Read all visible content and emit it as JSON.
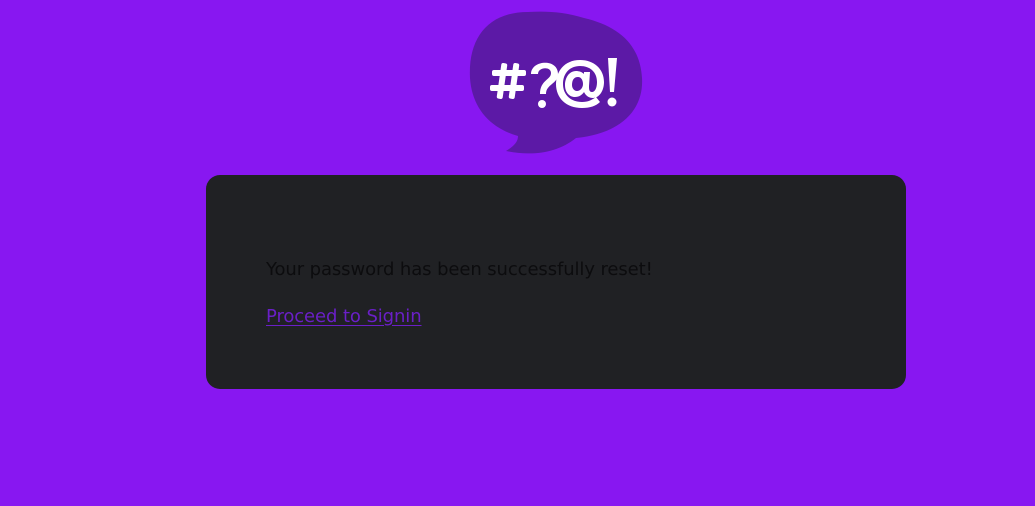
{
  "logo": {
    "icon": "speech-bubble-logo-icon",
    "bubble_color": "#5c19a6",
    "glyph_color": "#ffffff",
    "glyphs": "#?@!"
  },
  "card": {
    "message": "Your password has been successfully reset!",
    "link_label": "Proceed to Signin"
  },
  "colors": {
    "background": "#8817f1",
    "card": "#202124",
    "text": "#0c0c0e",
    "link": "#6a1fc7"
  }
}
